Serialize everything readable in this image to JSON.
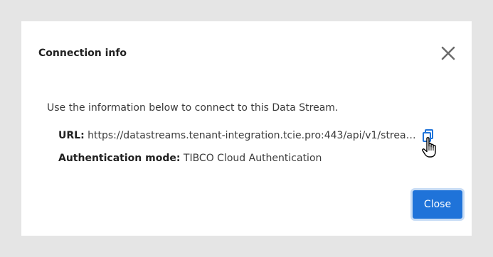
{
  "dialog": {
    "title": "Connection info",
    "intro": "Use the information below to connect to this Data Stream.",
    "url_label": "URL:",
    "url_value": "https://datastreams.tenant-integration.tcie.pro:443/api/v1/streams/…",
    "auth_label": "Authentication mode:",
    "auth_value": "TIBCO Cloud Authentication",
    "close_label": "Close"
  },
  "icons": {
    "close": "close-icon",
    "copy": "copy-icon",
    "cursor": "hand-pointer-cursor"
  },
  "colors": {
    "primary_button": "#1f73d9",
    "backdrop": "#e5e5e5",
    "copy_icon": "#1f73d9"
  }
}
